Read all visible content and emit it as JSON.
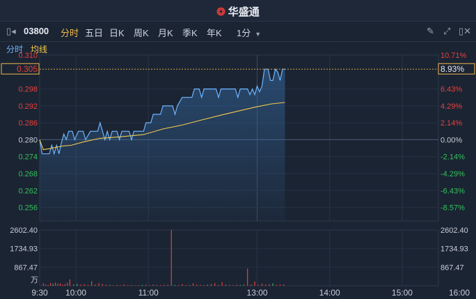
{
  "header": {
    "brand": "华盛通",
    "logo_icon": "weibo-like-logo-icon"
  },
  "toolbar": {
    "code": "03800",
    "tabs": [
      "分时",
      "五日",
      "日K",
      "周K",
      "月K",
      "季K",
      "年K"
    ],
    "active_tab": "分时",
    "interval": "1分"
  },
  "subbar": {
    "timeshare": "分时",
    "avg": "均线"
  },
  "colors": {
    "price": "#6fb6ff",
    "avg": "#f2c94c",
    "up": "#e8413c",
    "down": "#32c15b",
    "accent": "#f0b94a"
  },
  "chart_data": {
    "type": "line",
    "prev_close": 0.28,
    "current_price": "0.305",
    "current_pct": "8.93%",
    "price_ticks": [
      "0.310",
      "0.298",
      "0.292",
      "0.286",
      "0.280",
      "0.274",
      "0.268",
      "0.262",
      "0.256"
    ],
    "pct_ticks": [
      "10.71%",
      "6.43%",
      "4.29%",
      "2.14%",
      "0.00%",
      "-2.14%",
      "-4.29%",
      "-6.43%",
      "-8.57%"
    ],
    "ylim": [
      0.2512,
      0.31
    ],
    "x_labels": [
      "9:30",
      "10:00",
      "11:00",
      "13:00",
      "14:00",
      "15:00",
      "16:00"
    ],
    "volume_ticks": [
      "2602.40",
      "1734.93",
      "867.47"
    ],
    "volume_unit": "万",
    "volume_max": 2602.4,
    "price_series": [
      [
        0,
        0.28
      ],
      [
        2,
        0.275
      ],
      [
        8,
        0.275
      ],
      [
        10,
        0.278
      ],
      [
        12,
        0.275
      ],
      [
        14,
        0.278
      ],
      [
        16,
        0.275
      ],
      [
        18,
        0.279
      ],
      [
        20,
        0.282
      ],
      [
        22,
        0.28
      ],
      [
        24,
        0.283
      ],
      [
        27,
        0.283
      ],
      [
        29,
        0.28
      ],
      [
        32,
        0.283
      ],
      [
        36,
        0.283
      ],
      [
        38,
        0.28
      ],
      [
        42,
        0.283
      ],
      [
        48,
        0.283
      ],
      [
        50,
        0.286
      ],
      [
        52,
        0.283
      ],
      [
        54,
        0.28
      ],
      [
        56,
        0.283
      ],
      [
        58,
        0.28
      ],
      [
        60,
        0.283
      ],
      [
        64,
        0.283
      ],
      [
        66,
        0.28
      ],
      [
        68,
        0.283
      ],
      [
        74,
        0.283
      ],
      [
        76,
        0.28
      ],
      [
        78,
        0.283
      ],
      [
        86,
        0.283
      ],
      [
        88,
        0.286
      ],
      [
        92,
        0.286
      ],
      [
        94,
        0.289
      ],
      [
        100,
        0.289
      ],
      [
        102,
        0.292
      ],
      [
        110,
        0.292
      ],
      [
        112,
        0.289
      ],
      [
        114,
        0.292
      ],
      [
        118,
        0.295
      ],
      [
        126,
        0.295
      ],
      [
        128,
        0.298
      ],
      [
        132,
        0.298
      ],
      [
        134,
        0.295
      ],
      [
        136,
        0.298
      ],
      [
        146,
        0.298
      ],
      [
        148,
        0.295
      ],
      [
        150,
        0.298
      ],
      [
        162,
        0.298
      ],
      [
        164,
        0.295
      ],
      [
        166,
        0.298
      ],
      [
        172,
        0.298
      ],
      [
        174,
        0.296
      ],
      [
        176,
        0.298
      ],
      [
        178,
        0.296
      ],
      [
        180,
        0.299
      ],
      [
        182,
        0.297
      ],
      [
        184,
        0.299
      ],
      [
        186,
        0.305
      ],
      [
        189,
        0.305
      ],
      [
        191,
        0.301
      ],
      [
        193,
        0.301
      ],
      [
        195,
        0.305
      ],
      [
        197,
        0.304
      ],
      [
        199,
        0.301
      ],
      [
        201,
        0.305
      ],
      [
        203,
        0.305
      ]
    ],
    "avg_series": [
      [
        0,
        0.28
      ],
      [
        3,
        0.2765
      ],
      [
        8,
        0.2768
      ],
      [
        12,
        0.2772
      ],
      [
        16,
        0.2775
      ],
      [
        20,
        0.2778
      ],
      [
        26,
        0.278
      ],
      [
        36,
        0.2792
      ],
      [
        50,
        0.2805
      ],
      [
        66,
        0.281
      ],
      [
        86,
        0.2818
      ],
      [
        102,
        0.2838
      ],
      [
        118,
        0.2852
      ],
      [
        134,
        0.287
      ],
      [
        150,
        0.2887
      ],
      [
        166,
        0.2903
      ],
      [
        180,
        0.2917
      ],
      [
        192,
        0.2927
      ],
      [
        203,
        0.2932
      ]
    ],
    "volumes": [
      [
        3,
        120
      ],
      [
        5,
        60
      ],
      [
        7,
        40
      ],
      [
        9,
        130
      ],
      [
        11,
        90
      ],
      [
        13,
        150
      ],
      [
        15,
        100
      ],
      [
        17,
        110
      ],
      [
        19,
        60
      ],
      [
        21,
        80
      ],
      [
        23,
        140
      ],
      [
        25,
        300
      ],
      [
        28,
        70
      ],
      [
        31,
        90
      ],
      [
        34,
        60
      ],
      [
        37,
        80
      ],
      [
        40,
        40
      ],
      [
        43,
        220
      ],
      [
        46,
        60
      ],
      [
        49,
        120
      ],
      [
        52,
        80
      ],
      [
        55,
        50
      ],
      [
        58,
        40
      ],
      [
        61,
        30
      ],
      [
        64,
        40
      ],
      [
        67,
        20
      ],
      [
        70,
        60
      ],
      [
        73,
        30
      ],
      [
        76,
        40
      ],
      [
        79,
        20
      ],
      [
        82,
        30
      ],
      [
        85,
        40
      ],
      [
        88,
        50
      ],
      [
        91,
        30
      ],
      [
        94,
        60
      ],
      [
        97,
        40
      ],
      [
        100,
        30
      ],
      [
        103,
        40
      ],
      [
        106,
        50
      ],
      [
        109,
        2602.4
      ],
      [
        112,
        40
      ],
      [
        115,
        30
      ],
      [
        118,
        80
      ],
      [
        121,
        30
      ],
      [
        124,
        40
      ],
      [
        127,
        120
      ],
      [
        130,
        60
      ],
      [
        133,
        40
      ],
      [
        136,
        30
      ],
      [
        139,
        50
      ],
      [
        142,
        80
      ],
      [
        145,
        120
      ],
      [
        148,
        40
      ],
      [
        151,
        160
      ],
      [
        154,
        60
      ],
      [
        157,
        40
      ],
      [
        160,
        30
      ],
      [
        163,
        50
      ],
      [
        166,
        40
      ],
      [
        169,
        60
      ],
      [
        172,
        800
      ],
      [
        175,
        60
      ],
      [
        178,
        200
      ],
      [
        181,
        40
      ],
      [
        184,
        100
      ],
      [
        187,
        60
      ],
      [
        190,
        80
      ],
      [
        193,
        110
      ],
      [
        196,
        40
      ],
      [
        199,
        60
      ],
      [
        202,
        70
      ]
    ]
  }
}
